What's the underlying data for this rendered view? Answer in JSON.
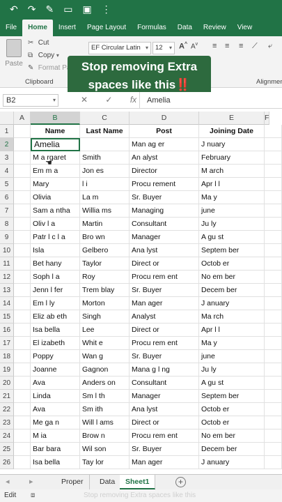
{
  "titlebar": {
    "undo": "↶",
    "redo": "↷",
    "brush": "✎",
    "folder": "▭",
    "save": "▣",
    "more": "⋮"
  },
  "tabs": [
    "File",
    "Home",
    "Insert",
    "Page Layout",
    "Formulas",
    "Data",
    "Review",
    "View"
  ],
  "active_tab": "Home",
  "ribbon": {
    "paste_label": "Paste",
    "cut_label": "Cut",
    "copy_label": "Copy",
    "format_painter_label": "Format Pa",
    "clipboard_group": "Clipboard",
    "alignment_group": "Alignmen",
    "font_name": "EF Circular Latin",
    "font_size": "12",
    "grow_font": "A",
    "shrink_font": "A"
  },
  "overlay": {
    "line1": "Stop removing Extra",
    "line2": "spaces like this",
    "emoji": "‼️"
  },
  "formula_bar": {
    "name_box": "B2",
    "cancel": "✕",
    "enter": "✓",
    "fx": "fx",
    "value": "Amelia"
  },
  "columns": [
    "A",
    "B",
    "C",
    "D",
    "E",
    "F"
  ],
  "header_row": [
    "Name",
    "Last Name",
    "Post",
    "Joining Date"
  ],
  "rows": [
    [
      "Amelia",
      "",
      "Man ag er",
      "J nuary"
    ],
    [
      "M a rgaret",
      "Smith",
      "An alyst",
      "February"
    ],
    [
      "Em m a",
      "Jon es",
      "Director",
      "M arch"
    ],
    [
      "Mary",
      "l i",
      "Procu rement",
      "Apr l l"
    ],
    [
      "Olivia",
      "La m",
      "Sr. Buyer",
      "Ma y"
    ],
    [
      "Sam a ntha",
      "Willia ms",
      "Managing",
      "june"
    ],
    [
      "Oliv l a",
      "Martin",
      "Consultant",
      "Ju ly"
    ],
    [
      "Patr l c l a",
      "Bro wn",
      "Manager",
      "A gu st"
    ],
    [
      "Isla",
      "Gelbero",
      "Ana lyst",
      "Septem ber"
    ],
    [
      "Bet hany",
      "Taylor",
      "Direct or",
      "Octob er"
    ],
    [
      "Soph l a",
      "Roy",
      "Procu rem ent",
      "No em ber"
    ],
    [
      "Jenn l fer",
      "Trem blay",
      "Sr. Buyer",
      "Decem ber"
    ],
    [
      "Em l ly",
      "Morton",
      "Man ager",
      "J anuary"
    ],
    [
      "Eliz ab eth",
      "Singh",
      "Analyst",
      "Ma rch"
    ],
    [
      "Isa bella",
      "Lee",
      "Direct or",
      "Apr l l"
    ],
    [
      "El izabeth",
      "Whit e",
      "Procu rem ent",
      "Ma y"
    ],
    [
      "Poppy",
      "Wan g",
      "Sr. Buyer",
      "june"
    ],
    [
      "Joanne",
      "Gagnon",
      "Mana g l ng",
      "Ju ly"
    ],
    [
      "Ava",
      "Anders on",
      "Consultant",
      "A gu st"
    ],
    [
      "Linda",
      "Sm l th",
      "Manager",
      "Septem ber"
    ],
    [
      "Ava",
      "Sm ith",
      "Ana lyst",
      "Octob er"
    ],
    [
      "Me ga n",
      "Will l ams",
      "Direct or",
      "Octob er"
    ],
    [
      "M ia",
      "Brow n",
      "Procu rem ent",
      "No em ber"
    ],
    [
      "Bar bara",
      "Wil son",
      "Sr. Buyer",
      "Decem ber"
    ],
    [
      "Isa bella",
      "Tay lor",
      "Man ager",
      "J anuary"
    ]
  ],
  "sheets": [
    "Proper",
    "Data",
    "Sheet1"
  ],
  "active_sheet": "Sheet1",
  "status": {
    "mode": "Edit",
    "ghost_text": "Stop removing Extra spaces like this"
  }
}
